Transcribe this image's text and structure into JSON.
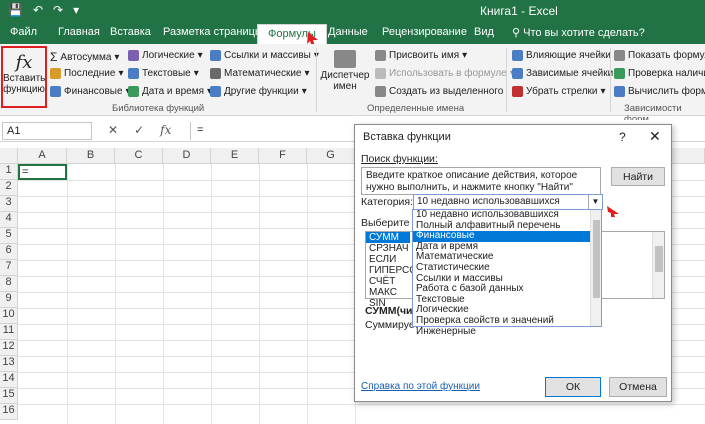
{
  "title_bar": {
    "window_title": "Книга1 - Excel",
    "undo": "↶",
    "redo": "↷",
    "customize": "▾"
  },
  "tabs": [
    "Файл",
    "Главная",
    "Вставка",
    "Разметка страницы",
    "Формулы",
    "Данные",
    "Рецензирование",
    "Вид",
    "Что вы хотите сделать?"
  ],
  "ribbon": {
    "insert_function": [
      "Вставить",
      "функцию"
    ],
    "library": {
      "autosum": "Автосумма",
      "recent": "Последние",
      "financial": "Финансовые",
      "logical": "Логические",
      "text": "Текстовые",
      "datetime": "Дата и время",
      "lookup": "Ссылки и массивы",
      "math": "Математические",
      "more": "Другие функции",
      "group_label": "Библиотека функций"
    },
    "names": {
      "manager": [
        "Диспетчер",
        "имен"
      ],
      "define": "Присвоить имя",
      "use": "Использовать в формуле",
      "create": "Создать из выделенного",
      "group_label": "Определенные имена"
    },
    "audit": {
      "trace_precedents": "Влияющие ячейки",
      "trace_dependents": "Зависимые ячейки",
      "remove_arrows": "Убрать стрелки",
      "show_formulas": "Показать формулы",
      "error_check": "Проверка наличия",
      "evaluate": "Вычислить формулу",
      "group_label": "Зависимости форм"
    }
  },
  "formula_bar": {
    "name_box": "A1",
    "cancel": "✕",
    "enter": "✓",
    "fx": "fx",
    "content": "="
  },
  "grid": {
    "columns": [
      "A",
      "B",
      "C",
      "D",
      "E",
      "F",
      "G"
    ],
    "rows": [
      "1",
      "2",
      "3",
      "4",
      "5",
      "6",
      "7",
      "8",
      "9",
      "10",
      "11",
      "12",
      "13",
      "14",
      "15",
      "16"
    ],
    "a1_value": "="
  },
  "dialog": {
    "title": "Вставка функции",
    "help": "?",
    "close": "✕",
    "search_label": "Поиск функции:",
    "search_text": "Введите краткое описание действия, которое нужно выполнить, и нажмите кнопку \"Найти\"",
    "find_button": "Найти",
    "category_label": "Категория:",
    "category_value": "10 недавно использовавшихся",
    "choose_label": "Выберите фу",
    "functions": [
      "СУММ",
      "СРЗНАЧ",
      "ЕСЛИ",
      "ГИПЕРССЫ",
      "СЧЁТ",
      "МАКС",
      "SIN"
    ],
    "signature": "СУММ(чис",
    "description": "Суммирует",
    "help_link": "Справка по этой функции",
    "ok": "ОК",
    "cancel": "Отмена"
  },
  "category_dropdown": [
    "10 недавно использовавшихся",
    "Полный алфавитный перечень",
    "Финансовые",
    "Дата и время",
    "Математические",
    "Статистические",
    "Ссылки и массивы",
    "Работа с базой данных",
    "Текстовые",
    "Логические",
    "Проверка свойств и значений",
    "Инженерные"
  ],
  "colors": {
    "excel_green": "#217346",
    "highlight": "#0078d7",
    "callout_red": "#e02020"
  }
}
